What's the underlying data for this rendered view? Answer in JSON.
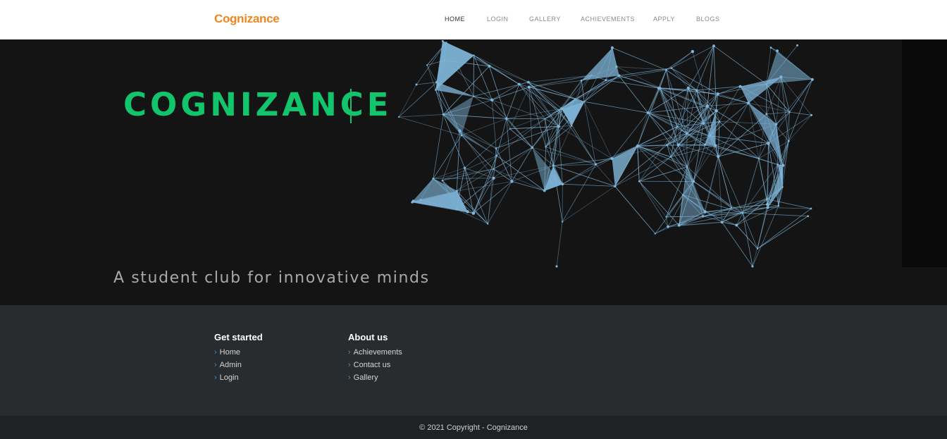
{
  "navbar": {
    "brand": "Cognizance",
    "items": [
      {
        "label": "HOME",
        "active": true
      },
      {
        "label": "LOGIN",
        "active": false
      },
      {
        "label": "GALLERY",
        "active": false
      },
      {
        "label": "ACHIEVEMENTS",
        "active": false
      },
      {
        "label": "APPLY",
        "active": false
      },
      {
        "label": "BLOGS",
        "active": false
      }
    ]
  },
  "hero": {
    "title": "COGNIZANCE",
    "subtitle": "A student club for innovative minds"
  },
  "footer": {
    "columns": [
      {
        "heading": "Get started",
        "links": [
          "Home",
          "Admin",
          "Login"
        ]
      },
      {
        "heading": "About us",
        "links": [
          "Achievements",
          "Contact us",
          "Gallery"
        ]
      }
    ],
    "copyright": "© 2021 Copyright - Cognizance"
  },
  "colors": {
    "brand_orange": "#f0861c",
    "hero_green": "#12c46c",
    "network_blue": "#7fb6d9",
    "footer_bg": "#292c2f",
    "link_chevron": "#3a8fd6"
  }
}
